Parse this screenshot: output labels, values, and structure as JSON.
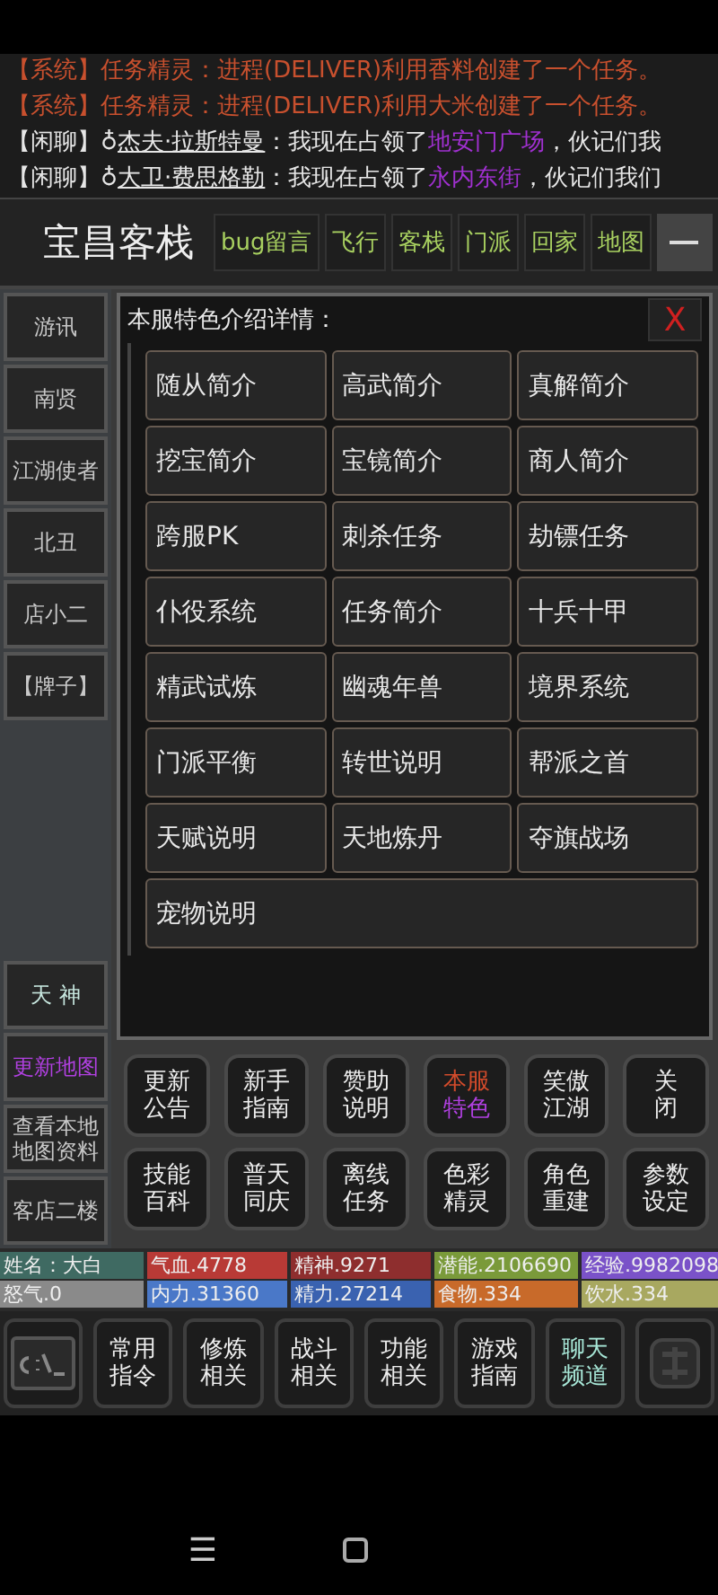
{
  "chat": [
    {
      "channel": "【系统】",
      "kind": "system",
      "segments": [
        {
          "text": "任务精灵：进程(DELIVER)利用香料创建了一个任务。",
          "kind": "plain"
        }
      ]
    },
    {
      "channel": "【系统】",
      "kind": "system",
      "segments": [
        {
          "text": "任务精灵：进程(DELIVER)利用大米创建了一个任务。",
          "kind": "plain"
        }
      ]
    },
    {
      "channel": "【闲聊】",
      "kind": "chat",
      "segments": [
        {
          "text": "♁",
          "kind": "plain"
        },
        {
          "text": "杰夫·拉斯特曼",
          "kind": "name"
        },
        {
          "text": "：我现在占领了",
          "kind": "plain"
        },
        {
          "text": "地安门广场",
          "kind": "place"
        },
        {
          "text": "，伙记们我",
          "kind": "plain"
        }
      ]
    },
    {
      "channel": "【闲聊】",
      "kind": "chat",
      "segments": [
        {
          "text": "♁",
          "kind": "plain"
        },
        {
          "text": "大卫·费思格勒",
          "kind": "name"
        },
        {
          "text": "：我现在占领了",
          "kind": "plain"
        },
        {
          "text": "永内东街",
          "kind": "place"
        },
        {
          "text": "，伙记们我们",
          "kind": "plain"
        }
      ]
    }
  ],
  "location": "宝昌客栈",
  "top_buttons": [
    "bug留言",
    "飞行",
    "客栈",
    "门派",
    "回家",
    "地图"
  ],
  "sidebar": {
    "items": [
      {
        "label": "游讯",
        "color": "#c8c8c8"
      },
      {
        "label": "南贤",
        "color": "#c8c8c8"
      },
      {
        "label": "江湖使者",
        "color": "#c8c8c8"
      },
      {
        "label": "北丑",
        "color": "#c8c8c8"
      },
      {
        "label": "店小二",
        "color": "#c8c8c8"
      },
      {
        "label": "【牌子】",
        "color": "#c8c8c8"
      }
    ],
    "lower_items": [
      {
        "label": "天  神",
        "color": "#c8e8e0"
      },
      {
        "label": "更新地图",
        "color": "#b040e0"
      },
      {
        "label": "查看本地地图资料",
        "color": "#c8c8c8"
      },
      {
        "label": "客店二楼",
        "color": "#c8c8c8"
      }
    ]
  },
  "panel": {
    "title": "本服特色介绍详情：",
    "close": "X",
    "items": [
      "随从简介",
      "高武简介",
      "真解简介",
      "挖宝简介",
      "宝镜简介",
      "商人简介",
      "跨服PK",
      "刺杀任务",
      "劫镖任务",
      "仆役系统",
      "任务简介",
      "十兵十甲",
      "精武试炼",
      "幽魂年兽",
      "境界系统",
      "门派平衡",
      "转世说明",
      "帮派之首",
      "天赋说明",
      "天地炼丹",
      "夺旗战场",
      "宠物说明"
    ]
  },
  "menu_buttons": [
    {
      "lines": [
        "更新",
        "公告"
      ],
      "selected": false
    },
    {
      "lines": [
        "新手",
        "指南"
      ],
      "selected": false
    },
    {
      "lines": [
        "赞助",
        "说明"
      ],
      "selected": false
    },
    {
      "lines": [
        "本服",
        "特色"
      ],
      "selected": true
    },
    {
      "lines": [
        "笑傲",
        "江湖"
      ],
      "selected": false
    },
    {
      "lines": [
        "关",
        "闭"
      ],
      "selected": false
    },
    {
      "lines": [
        "技能",
        "百科"
      ],
      "selected": false
    },
    {
      "lines": [
        "普天",
        "同庆"
      ],
      "selected": false
    },
    {
      "lines": [
        "离线",
        "任务"
      ],
      "selected": false
    },
    {
      "lines": [
        "色彩",
        "精灵"
      ],
      "selected": false
    },
    {
      "lines": [
        "角色",
        "重建"
      ],
      "selected": false
    },
    {
      "lines": [
        "参数",
        "设定"
      ],
      "selected": false
    }
  ],
  "stats": [
    {
      "text": "姓名：大白",
      "color": "#3f6a62"
    },
    {
      "text": "气血.4778",
      "color": "#b83a36"
    },
    {
      "text": "精神.9271",
      "color": "#8e2e2e"
    },
    {
      "text": "潜能.2106690",
      "color": "#7a9a3a"
    },
    {
      "text": "经验.9982098",
      "color": "#7a52c8"
    },
    {
      "text": "怒气.0",
      "color": "#8a8a8a"
    },
    {
      "text": "内力.31360",
      "color": "#4a78c8"
    },
    {
      "text": "精力.27214",
      "color": "#3a62b0"
    },
    {
      "text": "食物.334",
      "color": "#c86a2a"
    },
    {
      "text": "饮水.334",
      "color": "#a8a860"
    }
  ],
  "toolbar": [
    {
      "lines": [
        "常用",
        "指令"
      ],
      "selected": false
    },
    {
      "lines": [
        "修炼",
        "相关"
      ],
      "selected": false
    },
    {
      "lines": [
        "战斗",
        "相关"
      ],
      "selected": false
    },
    {
      "lines": [
        "功能",
        "相关"
      ],
      "selected": false
    },
    {
      "lines": [
        "游戏",
        "指南"
      ],
      "selected": false
    },
    {
      "lines": [
        "聊天",
        "频道"
      ],
      "selected": true
    }
  ],
  "nav": {
    "menu": "☰"
  }
}
